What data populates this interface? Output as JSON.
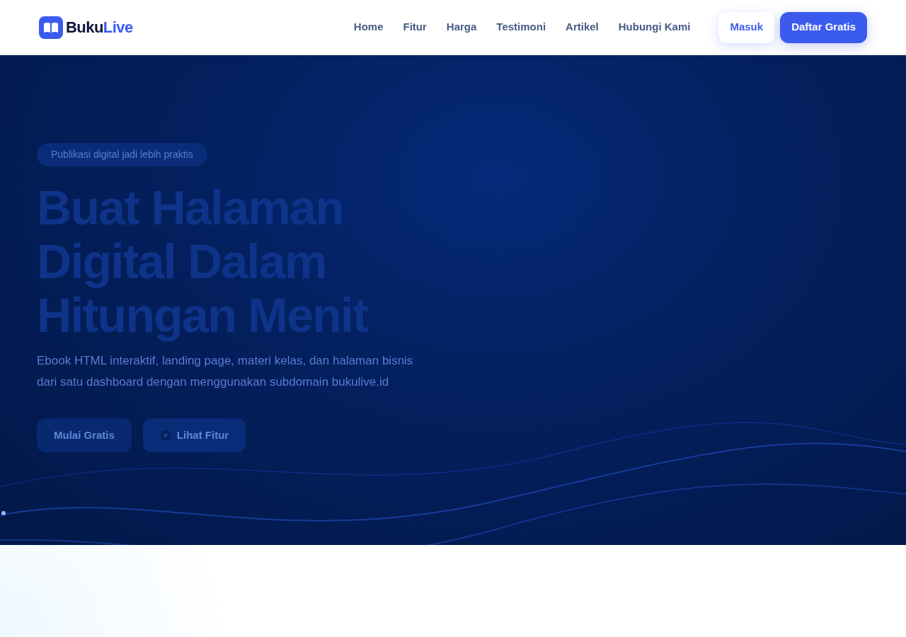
{
  "brand": {
    "part1": "Buku",
    "part2": "Live"
  },
  "nav": {
    "items": [
      {
        "label": "Home"
      },
      {
        "label": "Fitur"
      },
      {
        "label": "Harga"
      },
      {
        "label": "Testimoni"
      },
      {
        "label": "Artikel"
      },
      {
        "label": "Hubungi Kami"
      }
    ],
    "login": "Masuk",
    "signup": "Daftar Gratis"
  },
  "hero": {
    "badge": "Publikasi digital jadi lebih praktis",
    "title_lines": [
      "Buat Halaman",
      "Digital Dalam",
      "Hitungan Menit"
    ],
    "description": "Ebook HTML interaktif, landing page, materi kelas, dan halaman bisnis dari satu dashboard dengan menggunakan subdomain bukulive.id",
    "primary_button": "Mulai Gratis",
    "secondary_button": "Lihat Fitur"
  }
}
